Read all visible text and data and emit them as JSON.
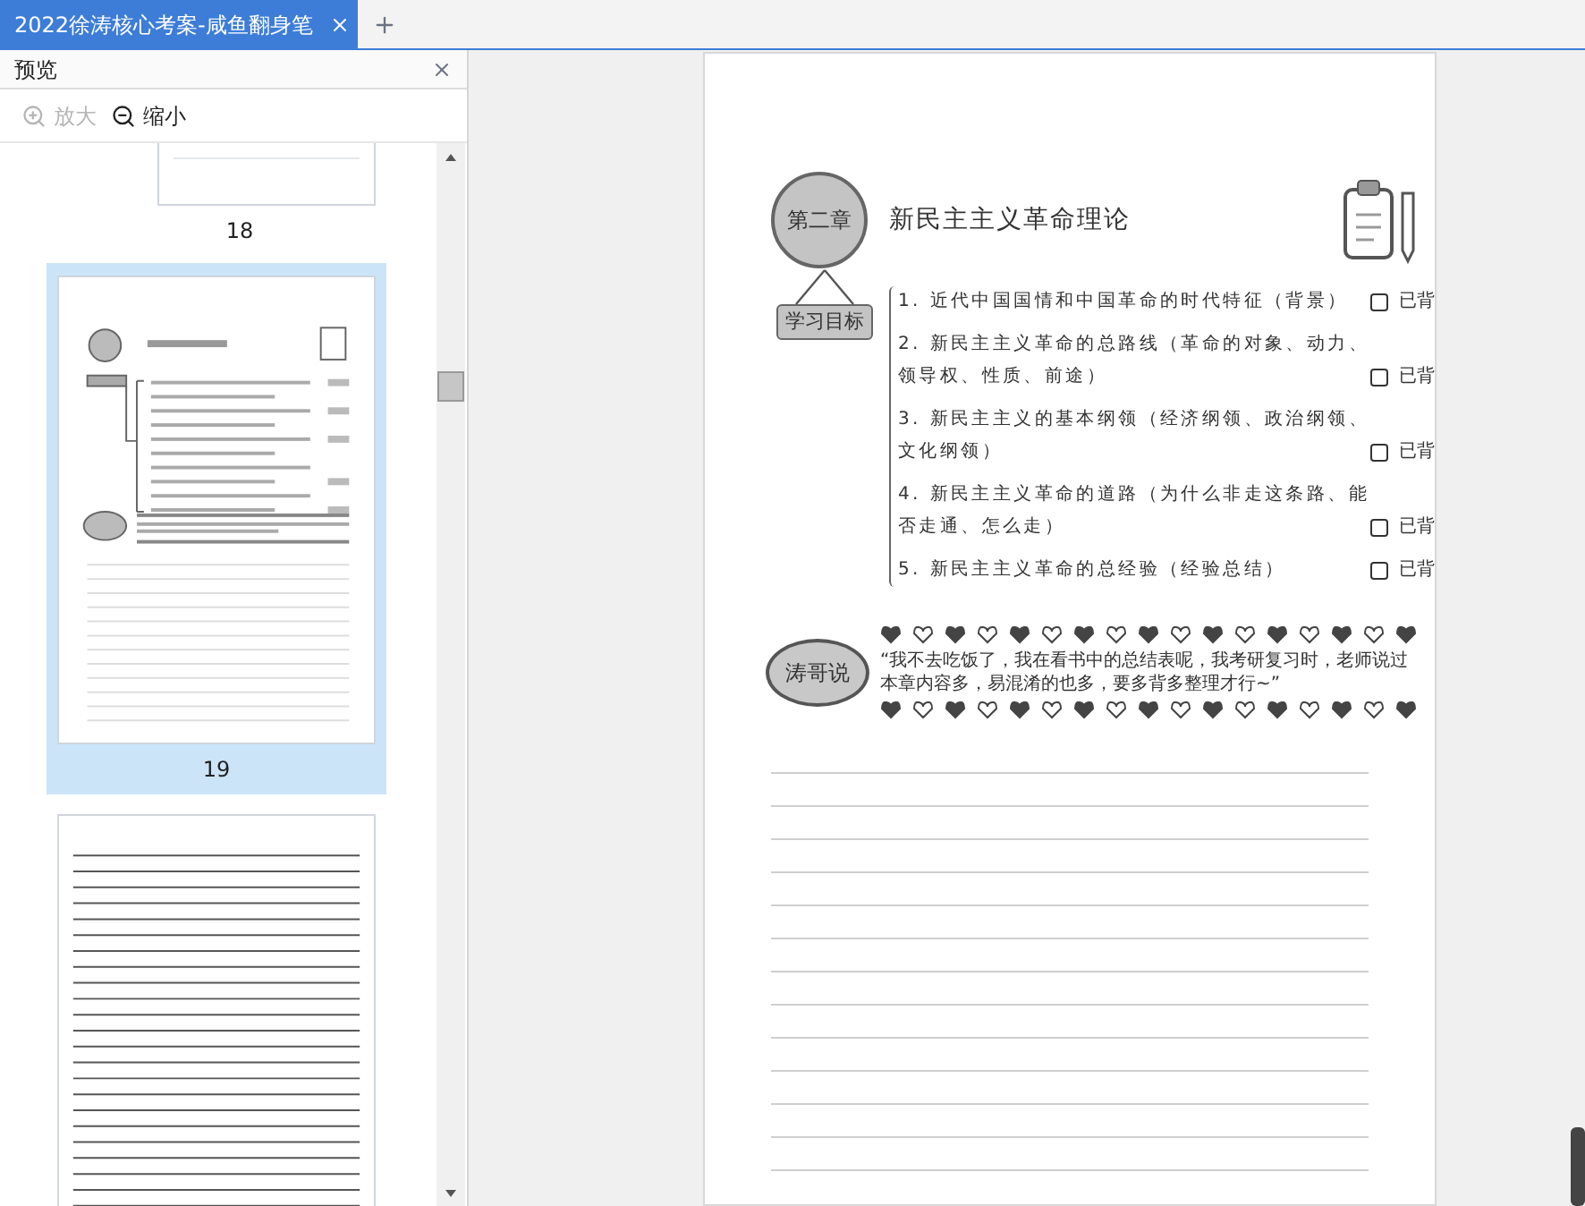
{
  "tabs": [
    {
      "label": "2022徐涛核心考案-咸鱼翻身笔",
      "selected": true
    }
  ],
  "sidebar": {
    "title": "预览",
    "toolbar": [
      {
        "label": "放大",
        "kind": "zoom-in",
        "disabled": true
      },
      {
        "label": "缩小",
        "kind": "zoom-out",
        "disabled": false
      }
    ],
    "thumbnails": [
      {
        "kind": "cut",
        "page": "18",
        "selected": false
      },
      {
        "kind": "chapter",
        "page": "19",
        "selected": true
      },
      {
        "kind": "lined",
        "selected": false
      }
    ]
  },
  "document": {
    "chapter_badge": "第二章",
    "title": "新民主主义革命理论",
    "goals_label": "学习目标",
    "goals": [
      {
        "text": "1. 近代中国国情和中国革命的时代特征（背景）",
        "checkbox_label": "已背",
        "checked": false
      },
      {
        "text": "2. 新民主主义革命的总路线（革命的对象、动力、领导权、性质、前途）",
        "checkbox_label": "已背",
        "checked": false
      },
      {
        "text": "3. 新民主主义的基本纲领（经济纲领、政治纲领、文化纲领）",
        "checkbox_label": "已背",
        "checked": false
      },
      {
        "text": "4. 新民主主义革命的道路（为什么非走这条路、能否走通、怎么走）",
        "checkbox_label": "已背",
        "checked": false
      },
      {
        "text": "5. 新民主主义革命的总经验（经验总结）",
        "checkbox_label": "已背",
        "checked": false
      }
    ],
    "speaker": "涛哥说",
    "quote": "“我不去吃饭了，我在看书中的总结表呢，我考研复习时，老师说过本章内容多，易混淆的也多，要多背多整理才行~”"
  }
}
